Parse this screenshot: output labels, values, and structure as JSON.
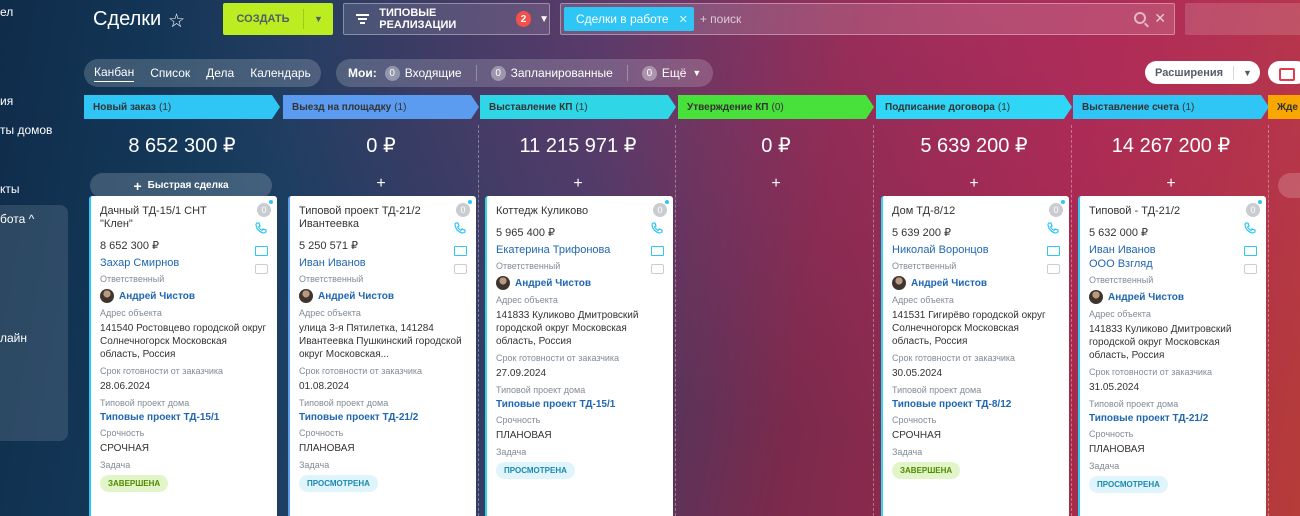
{
  "sidebar": {
    "items": [
      "ел",
      "ия",
      "ты домов",
      "кты",
      "бота ^",
      "лайн"
    ]
  },
  "header": {
    "title": "Сделки",
    "create_label": "СОЗДАТЬ",
    "filter_label": "ТИПОВЫЕ РЕАЛИЗАЦИИ",
    "filter_count": "2",
    "search_tag": "Сделки в работе",
    "search_placeholder": "+ поиск"
  },
  "toolbar": {
    "views": [
      "Канбан",
      "Список",
      "Дела",
      "Календарь"
    ],
    "mine_label": "Мои:",
    "counters": [
      {
        "count": "0",
        "label": "Входящие"
      },
      {
        "count": "0",
        "label": "Запланированные"
      },
      {
        "count": "0",
        "label": "Ещё"
      }
    ],
    "extensions_label": "Расширения"
  },
  "labels": {
    "quick_deal": "Быстрая сделка",
    "responsible": "Ответственный",
    "address": "Адрес объекта",
    "deadline": "Срок готовности от заказчика",
    "house_project": "Типовой проект дома",
    "urgency": "Срочность",
    "task": "Задача"
  },
  "colors": {
    "new": "#2fc6f6",
    "visit": "#5b9cf0",
    "kp": "#2fd6e6",
    "approve": "#48e03b",
    "contract": "#2fd6f6",
    "invoice": "#2fc6f6",
    "next": "#f7a700"
  },
  "columns": [
    {
      "name": "Новый заказ",
      "count": "(1)",
      "sum": "8 652 300 ₽",
      "card": {
        "title": "Дачный ТД-15/1 СНТ \"Клен\"",
        "amount": "8 652 300 ₽",
        "contact": "Захар Смирнов",
        "contact2": "",
        "responsible": "Андрей Чистов",
        "address": "141540 Ростовцево городской округ Солнечногорск Московская область, Россия",
        "deadline": "28.06.2024",
        "project": "Типовые проект ТД-15/1",
        "urgency": "СРОЧНАЯ",
        "task": "ЗАВЕРШЕНА",
        "task_style": "green"
      }
    },
    {
      "name": "Выезд на площадку",
      "count": "(1)",
      "sum": "0 ₽",
      "card": {
        "title": "Типовой проект ТД-21/2 Ивантеевка",
        "amount": "5 250 571 ₽",
        "contact": "Иван Иванов",
        "contact2": "",
        "responsible": "Андрей Чистов",
        "address": "улица 3-я Пятилетка, 141284 Ивантеевка Пушкинский городской округ Московская...",
        "deadline": "01.08.2024",
        "project": "Типовые проект ТД-21/2",
        "urgency": "ПЛАНОВАЯ",
        "task": "ПРОСМОТРЕНА",
        "task_style": "blue"
      }
    },
    {
      "name": "Выставление КП",
      "count": "(1)",
      "sum": "11 215 971 ₽",
      "card": {
        "title": "Коттедж Куликово",
        "amount": "5 965 400 ₽",
        "contact": "Екатерина Трифонова",
        "contact2": "",
        "responsible": "Андрей Чистов",
        "address": "141833 Куликово Дмитровский городской округ Московская область, Россия",
        "deadline": "27.09.2024",
        "project": "Типовые проект ТД-15/1",
        "urgency": "ПЛАНОВАЯ",
        "task": "ПРОСМОТРЕНА",
        "task_style": "blue"
      }
    },
    {
      "name": "Утверждение КП",
      "count": "(0)",
      "sum": "0 ₽",
      "card": null
    },
    {
      "name": "Подписание договора",
      "count": "(1)",
      "sum": "5 639 200 ₽",
      "card": {
        "title": "Дом ТД-8/12",
        "amount": "5 639 200 ₽",
        "contact": "Николай Воронцов",
        "contact2": "",
        "responsible": "Андрей Чистов",
        "address": "141531 Гигирёво городской округ Солнечногорск Московская область, Россия",
        "deadline": "30.05.2024",
        "project": "Типовые проект ТД-8/12",
        "urgency": "СРОЧНАЯ",
        "task": "ЗАВЕРШЕНА",
        "task_style": "green"
      }
    },
    {
      "name": "Выставление счета",
      "count": "(1)",
      "sum": "14 267 200 ₽",
      "card": {
        "title": "Типовой - ТД-21/2",
        "amount": "5 632 000 ₽",
        "contact": "Иван Иванов",
        "contact2": "ООО Взгляд",
        "responsible": "Андрей Чистов",
        "address": "141833 Куликово Дмитровский городской округ Московская область, Россия",
        "deadline": "31.05.2024",
        "project": "Типовые проект ТД-21/2",
        "urgency": "ПЛАНОВАЯ",
        "task": "ПРОСМОТРЕНА",
        "task_style": "blue"
      }
    }
  ],
  "next_column_name": "Жде"
}
